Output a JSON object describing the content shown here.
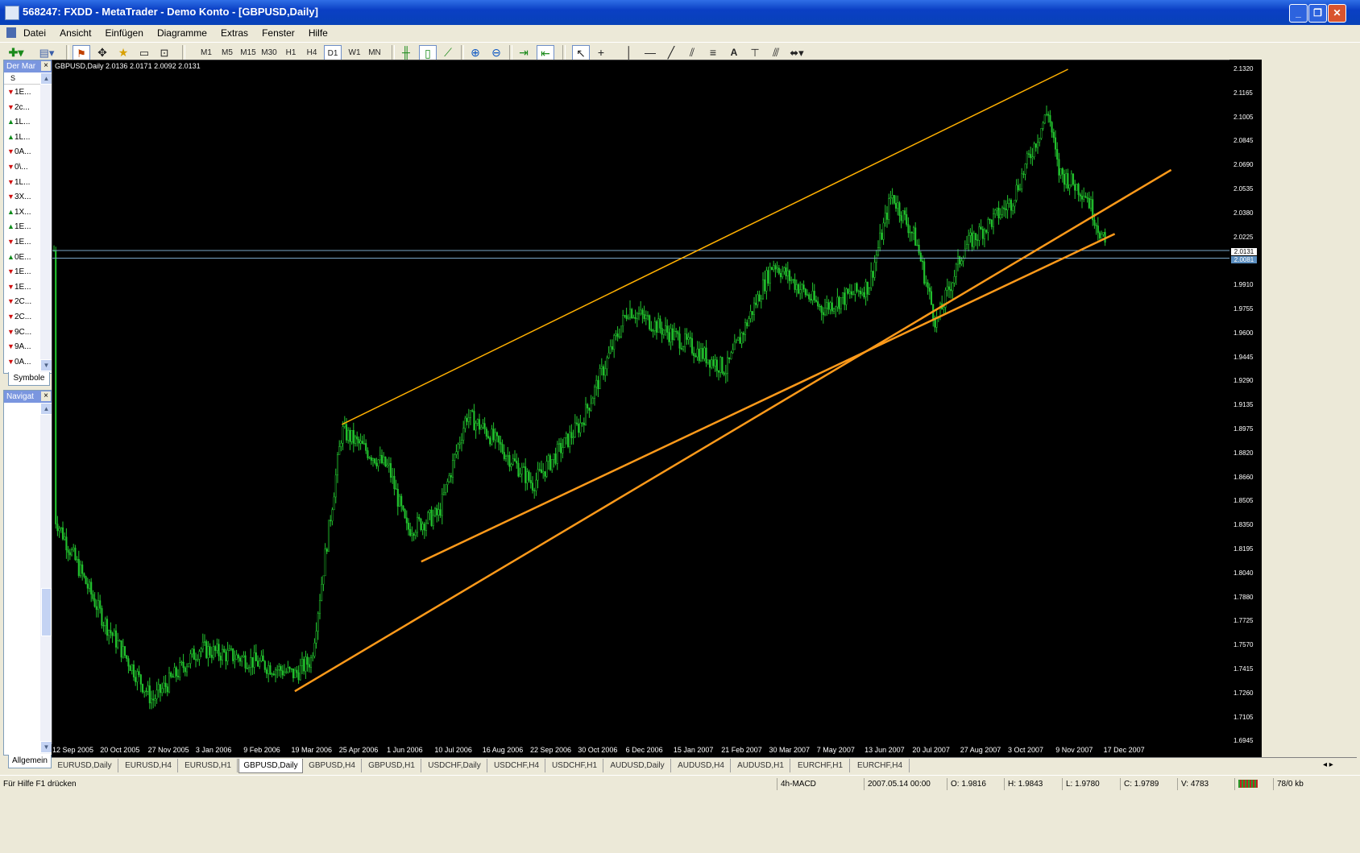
{
  "window": {
    "title": "568247: FXDD - MetaTrader - Demo Konto - [GBPUSD,Daily]"
  },
  "menu": [
    "Datei",
    "Ansicht",
    "Einfügen",
    "Diagramme",
    "Extras",
    "Fenster",
    "Hilfe"
  ],
  "toolbar": {
    "timeframes": [
      "M1",
      "M5",
      "M15",
      "M30",
      "H1",
      "H4",
      "D1",
      "W1",
      "MN"
    ],
    "active_timeframe": "D1"
  },
  "market_watch": {
    "title": "Der Mar",
    "column": "S",
    "rows": [
      {
        "dir": "dn",
        "text": "1E..."
      },
      {
        "dir": "dn",
        "text": "2c..."
      },
      {
        "dir": "up",
        "text": "1L..."
      },
      {
        "dir": "up",
        "text": "1L..."
      },
      {
        "dir": "dn",
        "text": "0A..."
      },
      {
        "dir": "dn",
        "text": "0\\..."
      },
      {
        "dir": "dn",
        "text": "1L..."
      },
      {
        "dir": "dn",
        "text": "3X..."
      },
      {
        "dir": "up",
        "text": "1X..."
      },
      {
        "dir": "up",
        "text": "1E..."
      },
      {
        "dir": "dn",
        "text": "1E..."
      },
      {
        "dir": "up",
        "text": "0E..."
      },
      {
        "dir": "dn",
        "text": "1E..."
      },
      {
        "dir": "dn",
        "text": "1E..."
      },
      {
        "dir": "dn",
        "text": "2C..."
      },
      {
        "dir": "dn",
        "text": "2C..."
      },
      {
        "dir": "dn",
        "text": "9C..."
      },
      {
        "dir": "dn",
        "text": "9A..."
      },
      {
        "dir": "dn",
        "text": "0A..."
      }
    ],
    "tab": "Symbole"
  },
  "navigator": {
    "title": "Navigat",
    "tab": "Allgemein"
  },
  "chart": {
    "info": "GBPUSD,Daily  2.0136 2.0171 2.0092 2.0131",
    "price_box": "2.0131",
    "price_box2": "2.0081",
    "colors": {
      "candles": "#22c32e",
      "trendline": "#ff9a1a",
      "trendline_light": "#ffb000",
      "hline": "#7aa6c8"
    }
  },
  "chart_data": {
    "type": "bar",
    "title": "GBPUSD,Daily",
    "y_ticks": [
      "2.1320",
      "2.1165",
      "2.1005",
      "2.0845",
      "2.0690",
      "2.0535",
      "2.0380",
      "2.0225",
      "2.0065",
      "1.9910",
      "1.9755",
      "1.9600",
      "1.9445",
      "1.9290",
      "1.9135",
      "1.8975",
      "1.8820",
      "1.8660",
      "1.8505",
      "1.8350",
      "1.8195",
      "1.8040",
      "1.7880",
      "1.7725",
      "1.7570",
      "1.7415",
      "1.7260",
      "1.7105",
      "1.6945"
    ],
    "x_ticks": [
      "12 Sep 2005",
      "20 Oct 2005",
      "27 Nov 2005",
      "3 Jan 2006",
      "9 Feb 2006",
      "19 Mar 2006",
      "25 Apr 2006",
      "1 Jun 2006",
      "10 Jul 2006",
      "16 Aug 2006",
      "22 Sep 2006",
      "30 Oct 2006",
      "6 Dec 2006",
      "15 Jan 2007",
      "21 Feb 2007",
      "30 Mar 2007",
      "7 May 2007",
      "13 Jun 2007",
      "20 Jul 2007",
      "27 Aug 2007",
      "3 Oct 2007",
      "9 Nov 2007",
      "17 Dec 2007"
    ],
    "ylim": [
      1.6945,
      2.132
    ],
    "price_path": [
      [
        "12 Sep 2005",
        1.837
      ],
      [
        "20 Oct 2005",
        1.77
      ],
      [
        "27 Nov 2005",
        1.718
      ],
      [
        "3 Jan 2006",
        1.752
      ],
      [
        "9 Feb 2006",
        1.745
      ],
      [
        "19 Mar 2006",
        1.735
      ],
      [
        "1 Apr 2006",
        1.745
      ],
      [
        "25 Apr 2006",
        1.895
      ],
      [
        "1 Jun 2006",
        1.87
      ],
      [
        "15 Jun 2006",
        1.83
      ],
      [
        "10 Jul 2006",
        1.84
      ],
      [
        "1 Aug 2006",
        1.905
      ],
      [
        "16 Aug 2006",
        1.895
      ],
      [
        "22 Sep 2006",
        1.86
      ],
      [
        "30 Oct 2006",
        1.9
      ],
      [
        "6 Dec 2006",
        1.975
      ],
      [
        "15 Jan 2007",
        1.955
      ],
      [
        "21 Feb 2007",
        1.935
      ],
      [
        "30 Mar 2007",
        2.005
      ],
      [
        "7 May 2007",
        1.975
      ],
      [
        "1 Jun 2007",
        1.985
      ],
      [
        "13 Jun 2007",
        1.99
      ],
      [
        "1 Jul 2007",
        2.05
      ],
      [
        "20 Jul 2007",
        2.02
      ],
      [
        "5 Aug 2007",
        1.965
      ],
      [
        "27 Aug 2007",
        2.015
      ],
      [
        "3 Oct 2007",
        2.045
      ],
      [
        "1 Nov 2007",
        2.105
      ],
      [
        "9 Nov 2007",
        2.065
      ],
      [
        "1 Dec 2007",
        2.05
      ],
      [
        "17 Dec 2007",
        2.0131
      ]
    ]
  },
  "chart_tabs": [
    "EURUSD,Daily",
    "EURUSD,H4",
    "EURUSD,H1",
    "GBPUSD,Daily",
    "GBPUSD,H4",
    "GBPUSD,H1",
    "USDCHF,Daily",
    "USDCHF,H4",
    "USDCHF,H1",
    "AUDUSD,Daily",
    "AUDUSD,H4",
    "AUDUSD,H1",
    "EURCHF,H1",
    "EURCHF,H4"
  ],
  "active_chart_tab": "GBPUSD,Daily",
  "status": {
    "help": "Für Hilfe F1 drücken",
    "profile": "4h-MACD",
    "datetime": "2007.05.14 00:00",
    "open": "O: 1.9816",
    "high": "H: 1.9843",
    "low": "L: 1.9780",
    "close": "C: 1.9789",
    "volume": "V: 4783",
    "traffic": "78/0 kb"
  }
}
